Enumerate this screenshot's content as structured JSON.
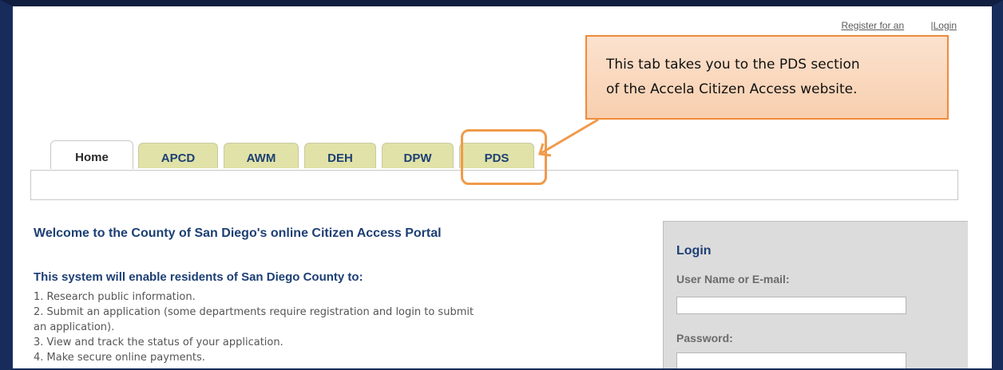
{
  "header": {
    "register_link": "Register for an",
    "login_link": "Login",
    "login_separator": "|"
  },
  "tabs": [
    {
      "label": "Home",
      "active": true
    },
    {
      "label": "APCD"
    },
    {
      "label": "AWM"
    },
    {
      "label": "DEH"
    },
    {
      "label": "DPW"
    },
    {
      "label": "PDS"
    }
  ],
  "content": {
    "welcome": "Welcome to the County of San Diego's online Citizen Access Portal",
    "subheading": "This system will enable residents of San Diego County to:",
    "items": [
      "1. Research public information.",
      "2. Submit an application (some departments require registration and login to submit",
      "an application).",
      "3. View and track the status of your application.",
      "4. Make secure online payments."
    ]
  },
  "login_panel": {
    "title": "Login",
    "username_label": "User Name or E-mail:",
    "password_label": "Password:",
    "username_value": "",
    "password_value": ""
  },
  "callout": {
    "line1": "This tab takes you to the PDS section",
    "line2": "of the Accela Citizen Access website."
  },
  "colors": {
    "frame": "#182c5c",
    "tab_bg": "#e0e2a7",
    "heading": "#1d3f74",
    "callout_border": "#ef8b3a",
    "callout_fill": "#f9d5b8"
  }
}
